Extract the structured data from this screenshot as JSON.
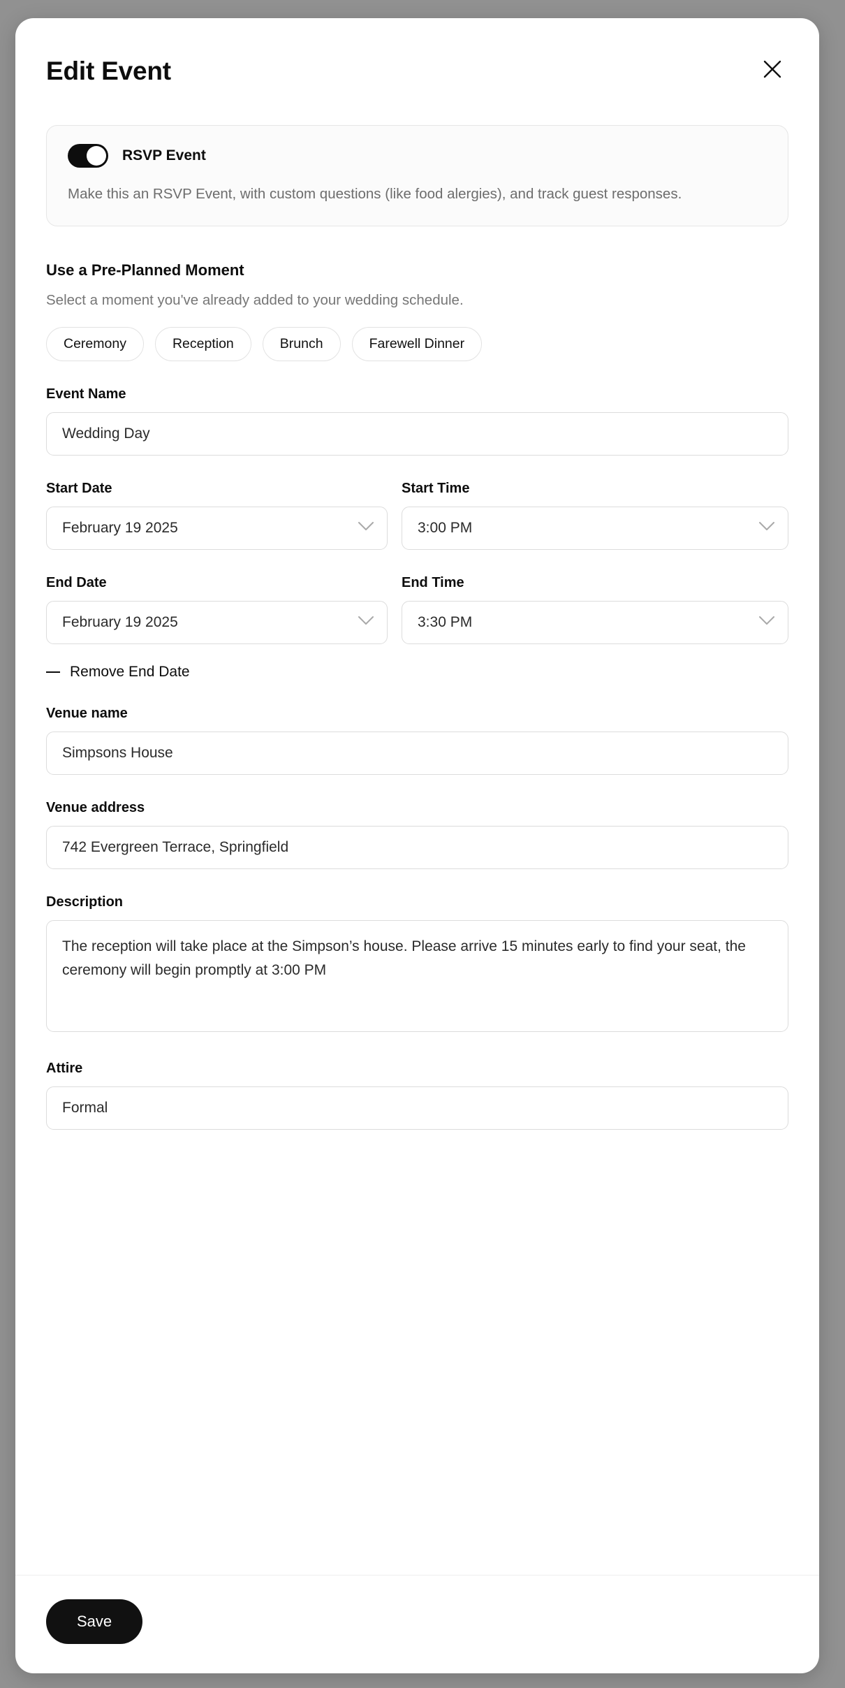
{
  "modal": {
    "title": "Edit Event",
    "close_icon": "close-icon"
  },
  "rsvp": {
    "toggle_state": "on",
    "label": "RSVP Event",
    "description": "Make this an RSVP Event, with custom questions (like food alergies), and track guest responses."
  },
  "preplanned": {
    "title": "Use a Pre-Planned Moment",
    "subtitle": "Select a moment you've already added to your wedding schedule.",
    "chips": [
      {
        "label": "Ceremony"
      },
      {
        "label": "Reception"
      },
      {
        "label": "Brunch"
      },
      {
        "label": "Farewell Dinner"
      }
    ]
  },
  "form": {
    "event_name": {
      "label": "Event Name",
      "value": "Wedding Day",
      "placeholder": "Event Name"
    },
    "start_date": {
      "label": "Start Date",
      "value": "February 19 2025"
    },
    "start_time": {
      "label": "Start Time",
      "value": "3:00 PM"
    },
    "end_date": {
      "label": "End Date",
      "value": "February 19 2025"
    },
    "end_time": {
      "label": "End Time",
      "value": "3:30 PM"
    },
    "remove_end_date": {
      "label": "Remove End Date",
      "icon": "minus-icon"
    },
    "venue_name": {
      "label": "Venue name",
      "value": "Simpsons House",
      "placeholder": "Venue name"
    },
    "venue_address": {
      "label": "Venue address",
      "value": "742 Evergreen Terrace, Springfield",
      "placeholder": "Venue address"
    },
    "description": {
      "label": "Description",
      "value": "The reception will take place at the Simpson’s house. Please arrive 15 minutes early to find your seat, the ceremony will begin promptly at 3:00 PM",
      "placeholder": "Description"
    },
    "attire": {
      "label": "Attire",
      "value": "Formal",
      "placeholder": "Attire"
    }
  },
  "footer": {
    "save_label": "Save"
  },
  "colors": {
    "backdrop": "#919191",
    "surface": "#ffffff",
    "accent": "#111111",
    "border": "#dcdcdc",
    "muted_text": "#767676",
    "card_bg": "#fbfbfb"
  }
}
